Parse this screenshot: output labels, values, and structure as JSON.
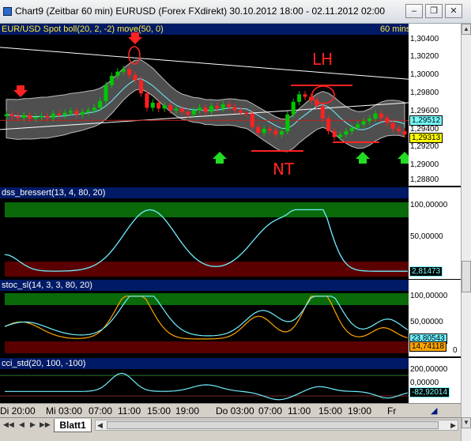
{
  "window": {
    "title": "Chart9 (Zeitbar 60 min)  EURUSD (Forex FXdirekt) 30.10.2012 18:00 - 02.11.2012 02:00",
    "minimize_label": "–",
    "restore_label": "❐",
    "close_label": "✕"
  },
  "panes": {
    "main": {
      "label": "EUR/USD Spot  boll(20, 2, -2)  move(50, 0)",
      "timeframe": "60 mins",
      "y_ticks": [
        "1,30400",
        "1,30200",
        "1,30000",
        "1,29800",
        "1,29600",
        "1,29400",
        "1,29200",
        "1,29000",
        "1,28800"
      ],
      "marker_cyan": "1,29512",
      "marker_yellow": "1,29313",
      "annotations": {
        "top": "LH",
        "bottom": "NT"
      }
    },
    "dss": {
      "label": "dss_bressert(13, 4, 80, 20)",
      "y_ticks": [
        "100,00000",
        "50,00000"
      ],
      "marker": "2,81473"
    },
    "stoc": {
      "label": "stoc_sl(14, 3, 3, 80, 20)",
      "y_ticks": [
        "100,00000",
        "50,00000"
      ],
      "marker_cyan": "23,80543",
      "marker_orange": "14,74118",
      "marker_zero": "0"
    },
    "cci": {
      "label": "cci_std(20, 100, -100)",
      "y_ticks": [
        "200,00000",
        "0,00000"
      ],
      "marker": "-82,92014"
    }
  },
  "x_axis": [
    "Di 20:00",
    "Mi 03:00",
    "07:00",
    "11:00",
    "15:00",
    "19:00",
    "Do 03:00",
    "07:00",
    "11:00",
    "15:00",
    "19:00",
    "Fr"
  ],
  "tabs": {
    "active": "Blatt1"
  },
  "colors": {
    "up_candle": "#00c800",
    "down_candle": "#ff2020",
    "cyan": "#6ff0ff",
    "orange": "#ffa500",
    "band": "#7a7a7a",
    "green_zone": "#0a6a0a",
    "red_zone": "#5a0000"
  },
  "chart_data": [
    {
      "type": "candlestick",
      "title": "EUR/USD Spot",
      "ylim": [
        1.287,
        1.305
      ],
      "close_approx": [
        1.2955,
        1.2953,
        1.2951,
        1.2954,
        1.295,
        1.2952,
        1.2953,
        1.2951,
        1.2956,
        1.2954,
        1.2957,
        1.2959,
        1.2955,
        1.2958,
        1.296,
        1.2963,
        1.2971,
        1.299,
        1.3001,
        1.3006,
        1.3009,
        1.3002,
        1.2996,
        1.298,
        1.2963,
        1.2969,
        1.2962,
        1.2966,
        1.296,
        1.2962,
        1.2958,
        1.2955,
        1.296,
        1.2963,
        1.2958,
        1.2965,
        1.2962,
        1.2967,
        1.2964,
        1.296,
        1.2957,
        1.2956,
        1.294,
        1.2933,
        1.2938,
        1.2936,
        1.2931,
        1.2935,
        1.2955,
        1.297,
        1.2979,
        1.2976,
        1.2972,
        1.2965,
        1.295,
        1.2935,
        1.2928,
        1.2931,
        1.2935,
        1.2939,
        1.2943,
        1.2947,
        1.295,
        1.2956,
        1.2951,
        1.2945,
        1.2938,
        1.2935,
        1.2931
      ]
    },
    {
      "type": "line",
      "title": "dss_bressert(13, 4, 80, 20)",
      "ylim": [
        0,
        100
      ]
    },
    {
      "type": "line",
      "title": "stoc_sl(14, 3, 3, 80, 20)",
      "ylim": [
        0,
        100
      ]
    },
    {
      "type": "line",
      "title": "cci_std(20, 100, -100)",
      "ylim": [
        -100,
        200
      ]
    }
  ]
}
